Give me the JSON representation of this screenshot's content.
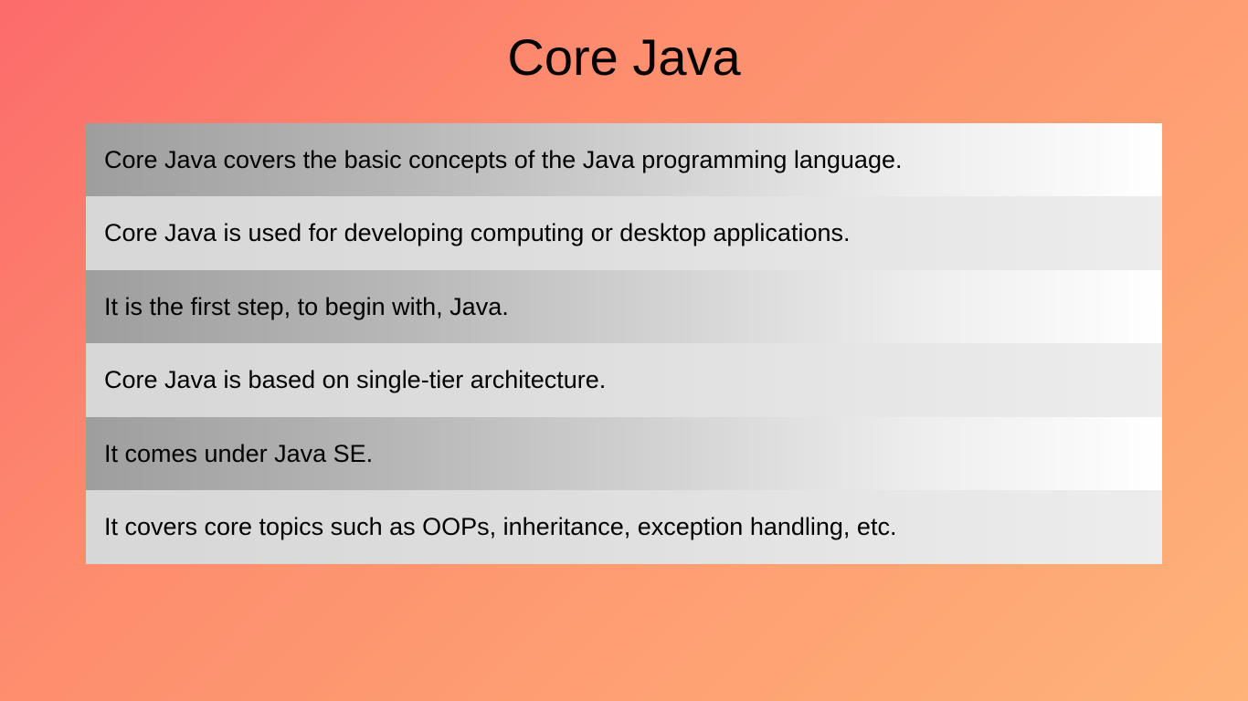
{
  "title": "Core Java",
  "rows": [
    "Core Java covers the basic concepts of the Java programming language.",
    "Core Java is used for developing computing or desktop applications.",
    "It is the first step, to begin with, Java.",
    "Core Java is based on single-tier architecture.",
    "It comes under Java SE.",
    "It covers core topics such as OOPs, inheritance, exception handling, etc."
  ]
}
